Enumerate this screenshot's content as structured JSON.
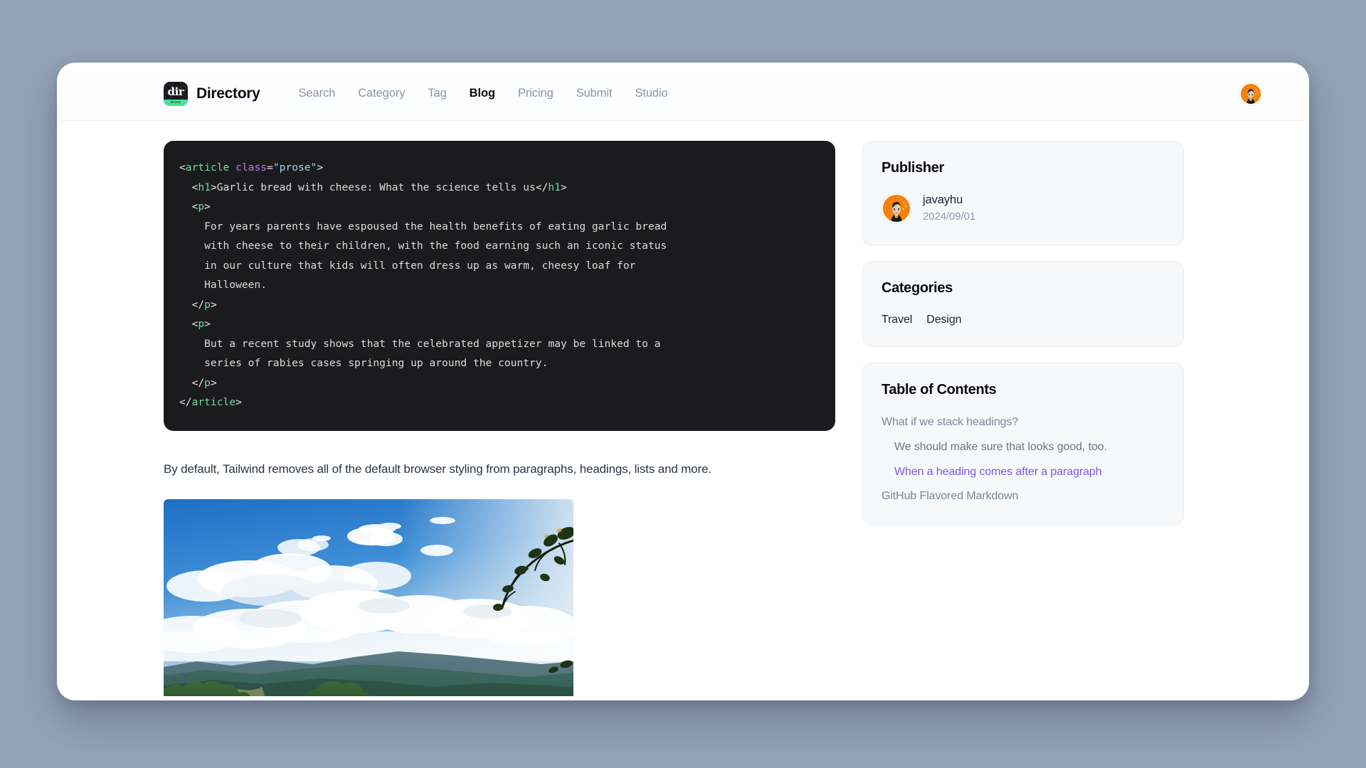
{
  "background_color": "#94a3b8",
  "header": {
    "logo": {
      "icon": "dir-logo-icon",
      "mark_text": "dir",
      "band_text": "MAKE",
      "background": "#18181b",
      "band_color": "#4ade9e"
    },
    "brand_name": "Directory",
    "nav": [
      {
        "label": "Search",
        "active": false
      },
      {
        "label": "Category",
        "active": false
      },
      {
        "label": "Tag",
        "active": false
      },
      {
        "label": "Blog",
        "active": true
      },
      {
        "label": "Pricing",
        "active": false
      },
      {
        "label": "Submit",
        "active": false
      },
      {
        "label": "Studio",
        "active": false
      }
    ],
    "account_avatar": "user-avatar"
  },
  "content": {
    "code_block": {
      "language": "html",
      "background": "#1b1b1d",
      "colors": {
        "tag": "#6fdd9b",
        "attribute": "#b07cf0",
        "string": "#9fd2ef",
        "text": "#dcdcdc"
      },
      "lines": [
        [
          {
            "t": "punc",
            "v": "<"
          },
          {
            "t": "tag",
            "v": "article"
          },
          {
            "t": "punc",
            "v": " "
          },
          {
            "t": "attr",
            "v": "class"
          },
          {
            "t": "punc",
            "v": "="
          },
          {
            "t": "str",
            "v": "\"prose\""
          },
          {
            "t": "punc",
            "v": ">"
          }
        ],
        [
          {
            "t": "punc",
            "v": "  <"
          },
          {
            "t": "tag",
            "v": "h1"
          },
          {
            "t": "punc",
            "v": ">"
          },
          {
            "t": "text",
            "v": "Garlic bread with cheese: What the science tells us"
          },
          {
            "t": "punc",
            "v": "</"
          },
          {
            "t": "tag",
            "v": "h1"
          },
          {
            "t": "punc",
            "v": ">"
          }
        ],
        [
          {
            "t": "punc",
            "v": "  <"
          },
          {
            "t": "tag",
            "v": "p"
          },
          {
            "t": "punc",
            "v": ">"
          }
        ],
        [
          {
            "t": "text",
            "v": "    For years parents have espoused the health benefits of eating garlic bread"
          }
        ],
        [
          {
            "t": "text",
            "v": "    with cheese to their children, with the food earning such an iconic status"
          }
        ],
        [
          {
            "t": "text",
            "v": "    in our culture that kids will often dress up as warm, cheesy loaf for"
          }
        ],
        [
          {
            "t": "text",
            "v": "    Halloween."
          }
        ],
        [
          {
            "t": "punc",
            "v": "  </"
          },
          {
            "t": "tag",
            "v": "p"
          },
          {
            "t": "punc",
            "v": ">"
          }
        ],
        [
          {
            "t": "punc",
            "v": "  <"
          },
          {
            "t": "tag",
            "v": "p"
          },
          {
            "t": "punc",
            "v": ">"
          }
        ],
        [
          {
            "t": "text",
            "v": "    But a recent study shows that the celebrated appetizer may be linked to a"
          }
        ],
        [
          {
            "t": "text",
            "v": "    series of rabies cases springing up around the country."
          }
        ],
        [
          {
            "t": "punc",
            "v": "  </"
          },
          {
            "t": "tag",
            "v": "p"
          },
          {
            "t": "punc",
            "v": ">"
          }
        ],
        [
          {
            "t": "punc",
            "v": "</"
          },
          {
            "t": "tag",
            "v": "article"
          },
          {
            "t": "punc",
            "v": ">"
          }
        ]
      ]
    },
    "paragraph": "By default, Tailwind removes all of the default browser styling from paragraphs, headings, lists and more.",
    "figure": {
      "name": "landscape-photo",
      "alt": "Blue sky with white clouds over green forested mountains, tree branch at upper right"
    }
  },
  "sidebar": {
    "publisher": {
      "title": "Publisher",
      "avatar": "publisher-avatar",
      "name": "javayhu",
      "date": "2024/09/01"
    },
    "categories": {
      "title": "Categories",
      "items": [
        "Travel",
        "Design"
      ]
    },
    "toc": {
      "title": "Table of Contents",
      "active_color": "#7c57e8",
      "items": [
        {
          "label": "What if we stack headings?",
          "level": 1,
          "active": false
        },
        {
          "label": "We should make sure that looks good, too.",
          "level": 2,
          "active": false
        },
        {
          "label": "When a heading comes after a paragraph",
          "level": 2,
          "active": true
        },
        {
          "label": "GitHub Flavored Markdown",
          "level": 1,
          "active": false
        }
      ]
    }
  }
}
